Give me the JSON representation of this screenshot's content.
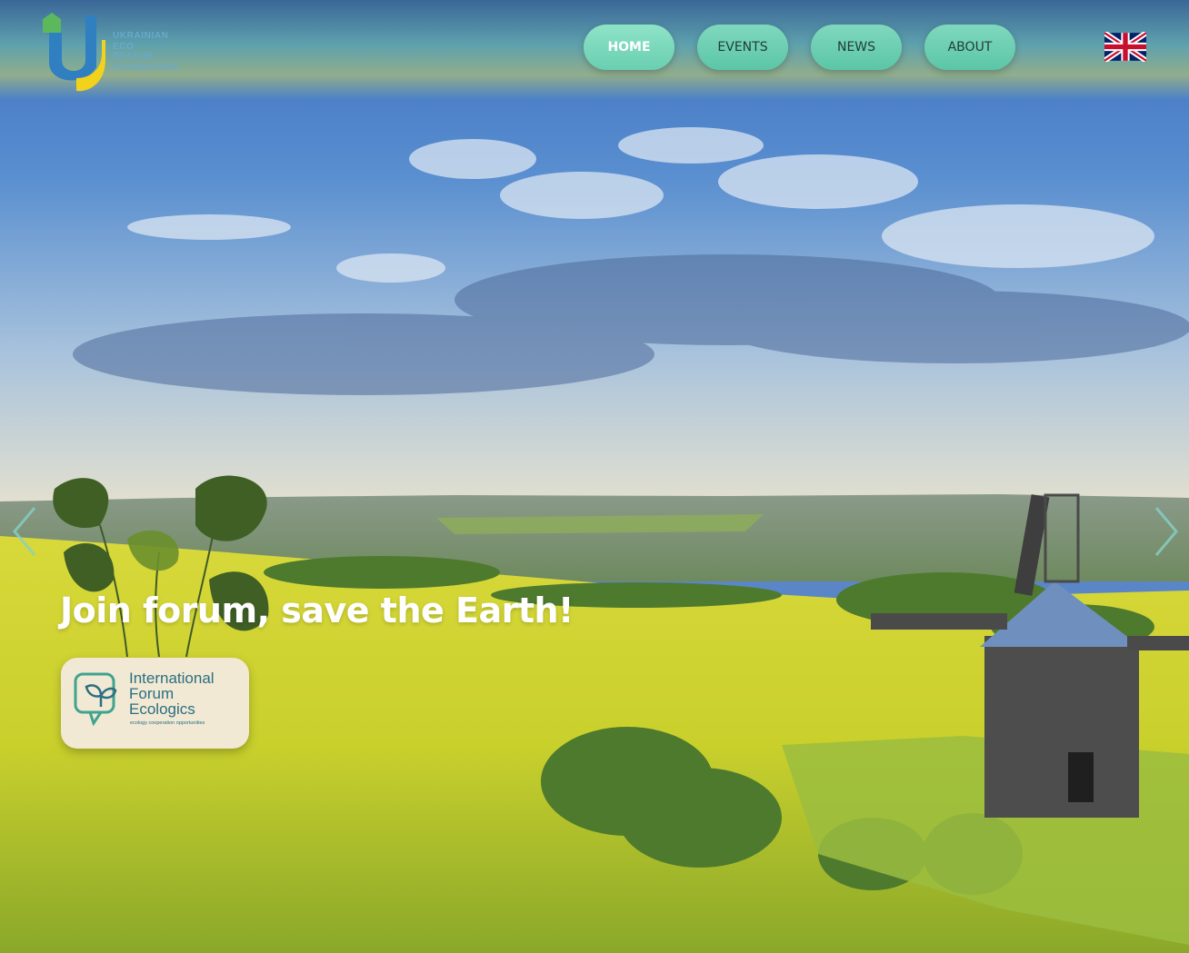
{
  "logo": {
    "lines": [
      "Ukrainian",
      "Eco",
      "Rescue",
      "Foundation"
    ],
    "icon": "leaf-u-logo"
  },
  "nav": {
    "items": [
      {
        "label": "HOME",
        "active": true
      },
      {
        "label": "EVENTS",
        "active": false
      },
      {
        "label": "NEWS",
        "active": false
      },
      {
        "label": "ABOUT",
        "active": false
      }
    ]
  },
  "language": {
    "icon": "uk-flag-icon"
  },
  "hero": {
    "headline": "Join forum, save the Earth!",
    "prev_icon": "chevron-left-icon",
    "next_icon": "chevron-right-icon"
  },
  "badge": {
    "title_lines": [
      "International",
      "Forum",
      "Ecologics"
    ],
    "subtitle": "ecology cooperation opportunities",
    "icon": "leaf-chat-icon"
  },
  "colors": {
    "nav_button": "#66cdb0",
    "nav_text": "#1f3d33",
    "badge_bg": "#f1e9d3",
    "badge_text": "#2c6e82",
    "logo_blue": "#2f7fc1",
    "logo_yellow": "#f2d21a",
    "logo_green": "#5cb85c"
  }
}
